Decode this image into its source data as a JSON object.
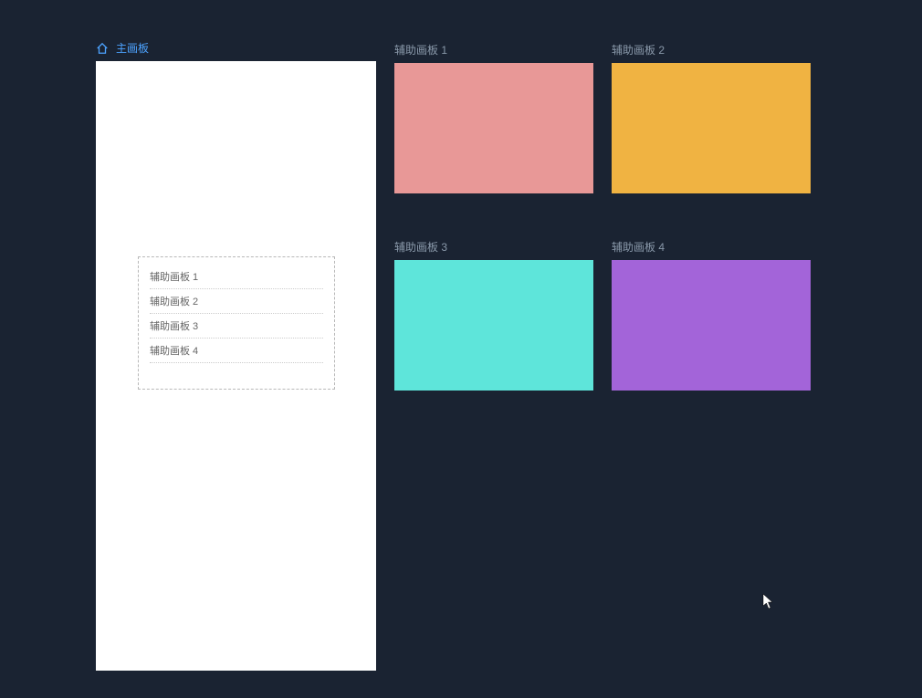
{
  "mainBoard": {
    "title": "主画板",
    "listItems": [
      "辅助画板 1",
      "辅助画板 2",
      "辅助画板 3",
      "辅助画板 4"
    ]
  },
  "auxBoards": [
    {
      "label": "辅助画板 1",
      "color": "#e89897"
    },
    {
      "label": "辅助画板 2",
      "color": "#f0b342"
    },
    {
      "label": "辅助画板 3",
      "color": "#5ee5da"
    },
    {
      "label": "辅助画板 4",
      "color": "#a364d9"
    }
  ]
}
